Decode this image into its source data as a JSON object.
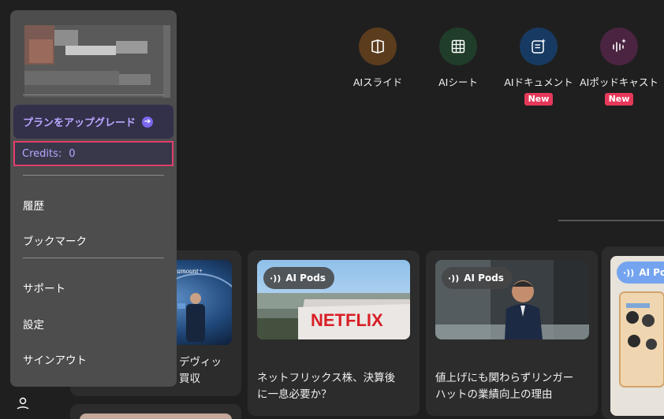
{
  "tools": [
    {
      "label": "AIスライド",
      "icon": "slides-icon",
      "color": "#5b3c1d",
      "badge": ""
    },
    {
      "label": "AIシート",
      "icon": "sheet-grid-icon",
      "color": "#1f3d29",
      "badge": ""
    },
    {
      "label": "AIドキュメント",
      "icon": "document-icon",
      "color": "#173a62",
      "badge": "New"
    },
    {
      "label": "AIポッドキャスト",
      "icon": "podcast-icon",
      "color": "#4a2440",
      "badge": "New"
    }
  ],
  "menu": {
    "upgrade_label": "プランをアップグレード",
    "credits_label": "Credits:",
    "credits_value": "0",
    "items": [
      "履歴",
      "ブックマーク",
      "サポート",
      "設定",
      "サインアウト"
    ]
  },
  "cards": [
    {
      "title_lines": [
        "デヴィッ",
        "買収"
      ]
    },
    {
      "pill": "AI Pods",
      "title_lines": [
        "ネットフリックス株、決算後",
        "に一息必要か？"
      ]
    },
    {
      "pill": "AI Pods",
      "title_lines": [
        "値上げにも関わらずリンガー",
        "ハットの業績向上の理由"
      ]
    },
    {
      "pill": "AI Po"
    }
  ],
  "images": {
    "paramount_text": "Paramount+",
    "netflix_text": "NETFLIX"
  }
}
